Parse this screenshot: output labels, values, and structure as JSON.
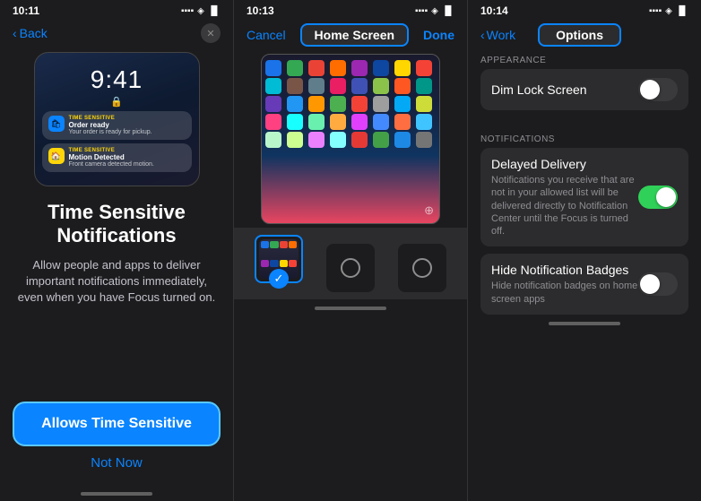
{
  "panel1": {
    "statusTime": "10:11",
    "navBack": "Back",
    "lockscreenTime": "9:41",
    "notification1": {
      "badge": "TIME SENSITIVE",
      "title": "Order ready",
      "body": "Your order is ready for pickup."
    },
    "notification2": {
      "badge": "TIME SENSITIVE",
      "title": "Motion Detected",
      "body": "Front camera detected motion."
    },
    "title": "Time Sensitive\nNotifications",
    "body": "Allow people and apps to deliver important notifications immediately, even when you have Focus turned on.",
    "allowsBtn": "Allows Time Sensitive",
    "notNowBtn": "Not Now"
  },
  "panel2": {
    "statusTime": "10:13",
    "navCancel": "Cancel",
    "navTitle": "Home Screen",
    "navDone": "Done"
  },
  "panel3": {
    "statusTime": "10:14",
    "navBack": "Work",
    "navTitle": "Options",
    "sections": {
      "appearance": {
        "label": "APPEARANCE",
        "dimLockScreen": {
          "label": "Dim Lock Screen",
          "enabled": false
        }
      },
      "notifications": {
        "label": "NOTIFICATIONS",
        "delayedDelivery": {
          "label": "Delayed Delivery",
          "sublabel": "Notifications you receive that are not in your allowed list will be delivered directly to Notification Center until the Focus is turned off.",
          "enabled": true
        },
        "hideNotificationBadges": {
          "label": "Hide Notification Badges",
          "sublabel": "Hide notification badges on home screen apps",
          "enabled": false
        }
      }
    }
  }
}
